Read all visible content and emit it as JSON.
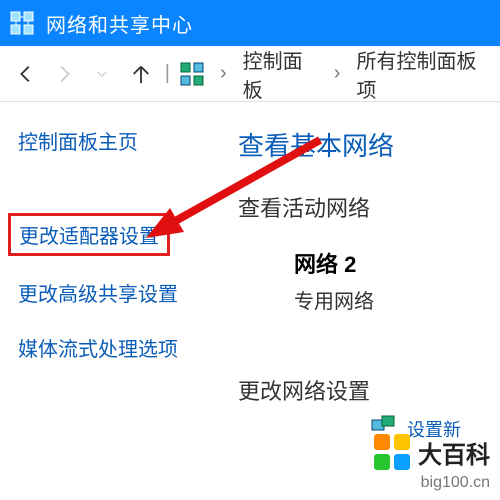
{
  "window": {
    "title": "网络和共享中心"
  },
  "breadcrumb": {
    "item1": "控制面板",
    "item2": "所有控制面板项"
  },
  "sidebar": {
    "home": "控制面板主页",
    "adapter": "更改适配器设置",
    "sharing": "更改高级共享设置",
    "media": "媒体流式处理选项"
  },
  "main": {
    "heading": "查看基本网络",
    "active_heading": "查看活动网络",
    "network_name": "网络  2",
    "network_type": "专用网络",
    "change_heading": "更改网络设置",
    "setup_truncated": "设置新"
  },
  "watermark": {
    "brand": "大百科",
    "url": "big100.cn"
  }
}
